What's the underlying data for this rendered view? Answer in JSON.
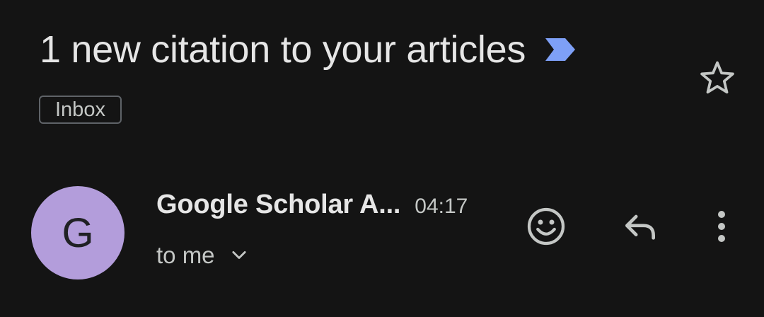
{
  "email": {
    "subject": "1 new citation to your articles",
    "label": "Inbox",
    "sender_initial": "G",
    "sender_name": "Google Scholar A...",
    "time": "04:17",
    "recipient": "to me"
  },
  "icons": {
    "importance": "importance-marker-icon",
    "star": "star-outline-icon",
    "emoji": "emoji-smile-icon",
    "reply": "reply-icon",
    "more": "more-vert-icon",
    "chevron": "chevron-down-icon"
  },
  "colors": {
    "background": "#141414",
    "importance_marker": "#7ea0f7",
    "avatar": "#b39ddb",
    "text_primary": "#e6e6e6",
    "text_secondary": "#c4c7c5"
  }
}
